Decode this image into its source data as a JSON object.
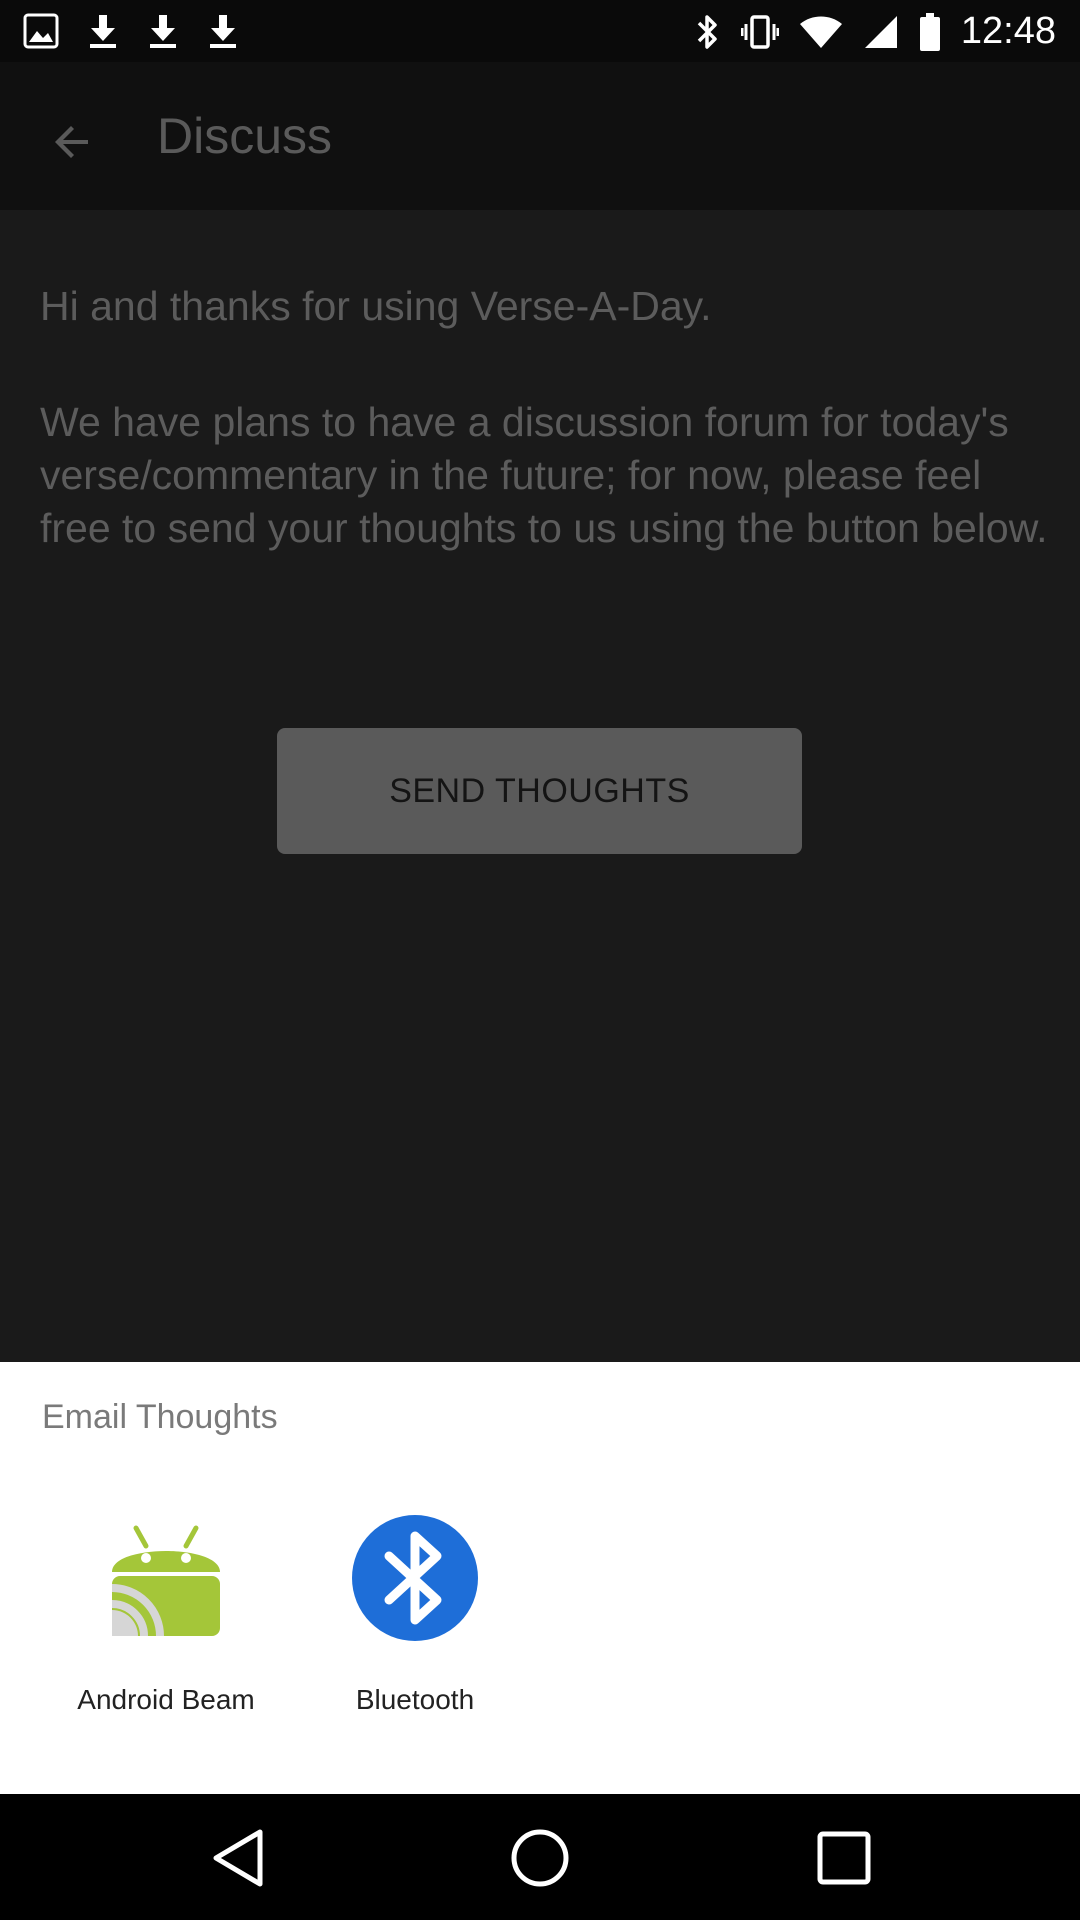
{
  "status_bar": {
    "time": "12:48",
    "left_icons": [
      "gallery-icon",
      "download-icon",
      "download-icon",
      "download-icon"
    ],
    "right_icons": [
      "bluetooth-icon",
      "vibrate-icon",
      "wifi-icon",
      "signal-icon",
      "battery-icon"
    ]
  },
  "app_bar": {
    "title": "Discuss"
  },
  "content": {
    "greeting": "Hi and thanks for using Verse-A-Day.",
    "body": "We have plans to have a discussion forum for today's verse/commentary in the future; for now, please feel free to send your thoughts to us using the button below.",
    "send_button_label": "SEND THOUGHTS"
  },
  "share_sheet": {
    "title": "Email Thoughts",
    "targets": [
      {
        "label": "Android Beam",
        "icon": "android-beam-icon",
        "color": "#a4c639"
      },
      {
        "label": "Bluetooth",
        "icon": "bluetooth-icon",
        "color": "#1e6ed8"
      }
    ]
  },
  "nav_bar": {
    "buttons": [
      "back-icon",
      "home-icon",
      "recents-icon"
    ]
  }
}
